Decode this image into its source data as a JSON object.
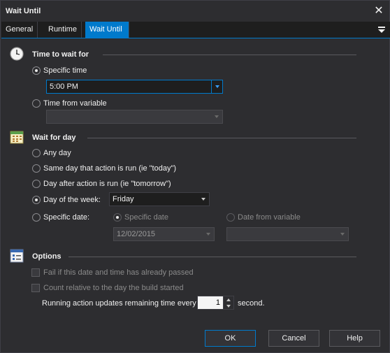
{
  "window": {
    "title": "Wait Until"
  },
  "tabs": [
    {
      "label": "General"
    },
    {
      "label": "Runtime"
    },
    {
      "label": "Wait Until"
    }
  ],
  "time_section": {
    "title": "Time to wait for",
    "specific_time_label": "Specific time",
    "specific_time_value": "5:00 PM",
    "time_from_variable_label": "Time from variable",
    "variable_value": ""
  },
  "day_section": {
    "title": "Wait for day",
    "any_day_label": "Any day",
    "same_day_label": "Same day that action is run (ie \"today\")",
    "day_after_label": "Day after action is run (ie \"tomorrow\")",
    "day_of_week_label": "Day of the week:",
    "day_of_week_value": "Friday",
    "specific_date_label": "Specific date:",
    "specific_date_sub_label": "Specific date",
    "specific_date_value": "12/02/2015",
    "date_from_variable_label": "Date from variable",
    "date_variable_value": ""
  },
  "options_section": {
    "title": "Options",
    "fail_if_passed_label": "Fail if this date and time has already passed",
    "count_relative_label": "Count relative to the day the build started",
    "updates_prefix": "Running action updates remaining time every",
    "updates_value": "1",
    "updates_suffix": "second."
  },
  "buttons": {
    "ok": "OK",
    "cancel": "Cancel",
    "help": "Help"
  },
  "colors": {
    "background": "#2d2d30",
    "accent": "#007acc",
    "text": "#f0f0f0",
    "disabled_text": "#8a8a8a"
  }
}
